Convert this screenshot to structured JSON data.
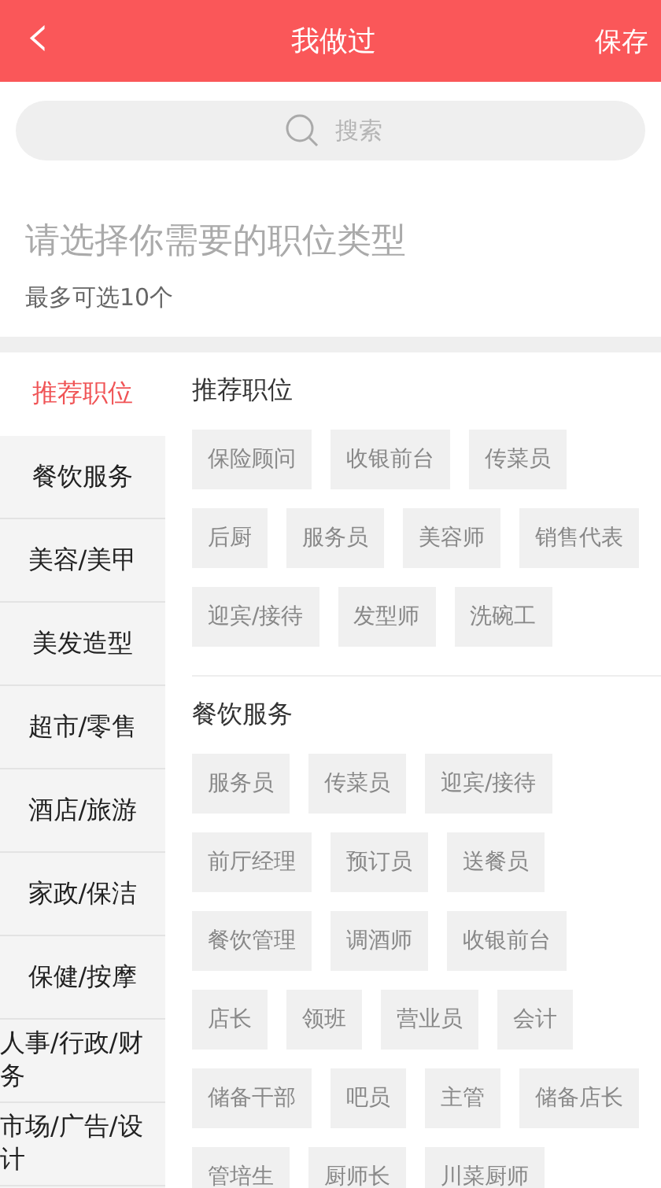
{
  "header": {
    "back": "‹",
    "title": "我做过",
    "action": "保存"
  },
  "search": {
    "placeholder": "搜索"
  },
  "prompt": {
    "title": "请选择你需要的职位类型",
    "hint": "最多可选10个"
  },
  "categories": [
    {
      "label": "推荐职位",
      "selected": true
    },
    {
      "label": "餐饮服务",
      "selected": false
    },
    {
      "label": "美容/美甲",
      "selected": false
    },
    {
      "label": "美发造型",
      "selected": false
    },
    {
      "label": "超市/零售",
      "selected": false
    },
    {
      "label": "酒店/旅游",
      "selected": false
    },
    {
      "label": "家政/保洁",
      "selected": false
    },
    {
      "label": "保健/按摩",
      "selected": false
    },
    {
      "label": "人事/行政/财务",
      "selected": false
    },
    {
      "label": "市场/广告/设计",
      "selected": false
    }
  ],
  "sections": [
    {
      "title": "推荐职位",
      "tags": [
        "保险顾问",
        "收银前台",
        "传菜员",
        "后厨",
        "服务员",
        "美容师",
        "销售代表",
        "迎宾/接待",
        "发型师",
        "洗碗工"
      ]
    },
    {
      "title": "餐饮服务",
      "tags": [
        "服务员",
        "传菜员",
        "迎宾/接待",
        "前厅经理",
        "预订员",
        "送餐员",
        "餐饮管理",
        "调酒师",
        "收银前台",
        "店长",
        "领班",
        "营业员",
        "会计",
        "储备干部",
        "吧员",
        "主管",
        "储备店长",
        "管培生",
        "厨师长",
        "川菜厨师"
      ]
    }
  ]
}
